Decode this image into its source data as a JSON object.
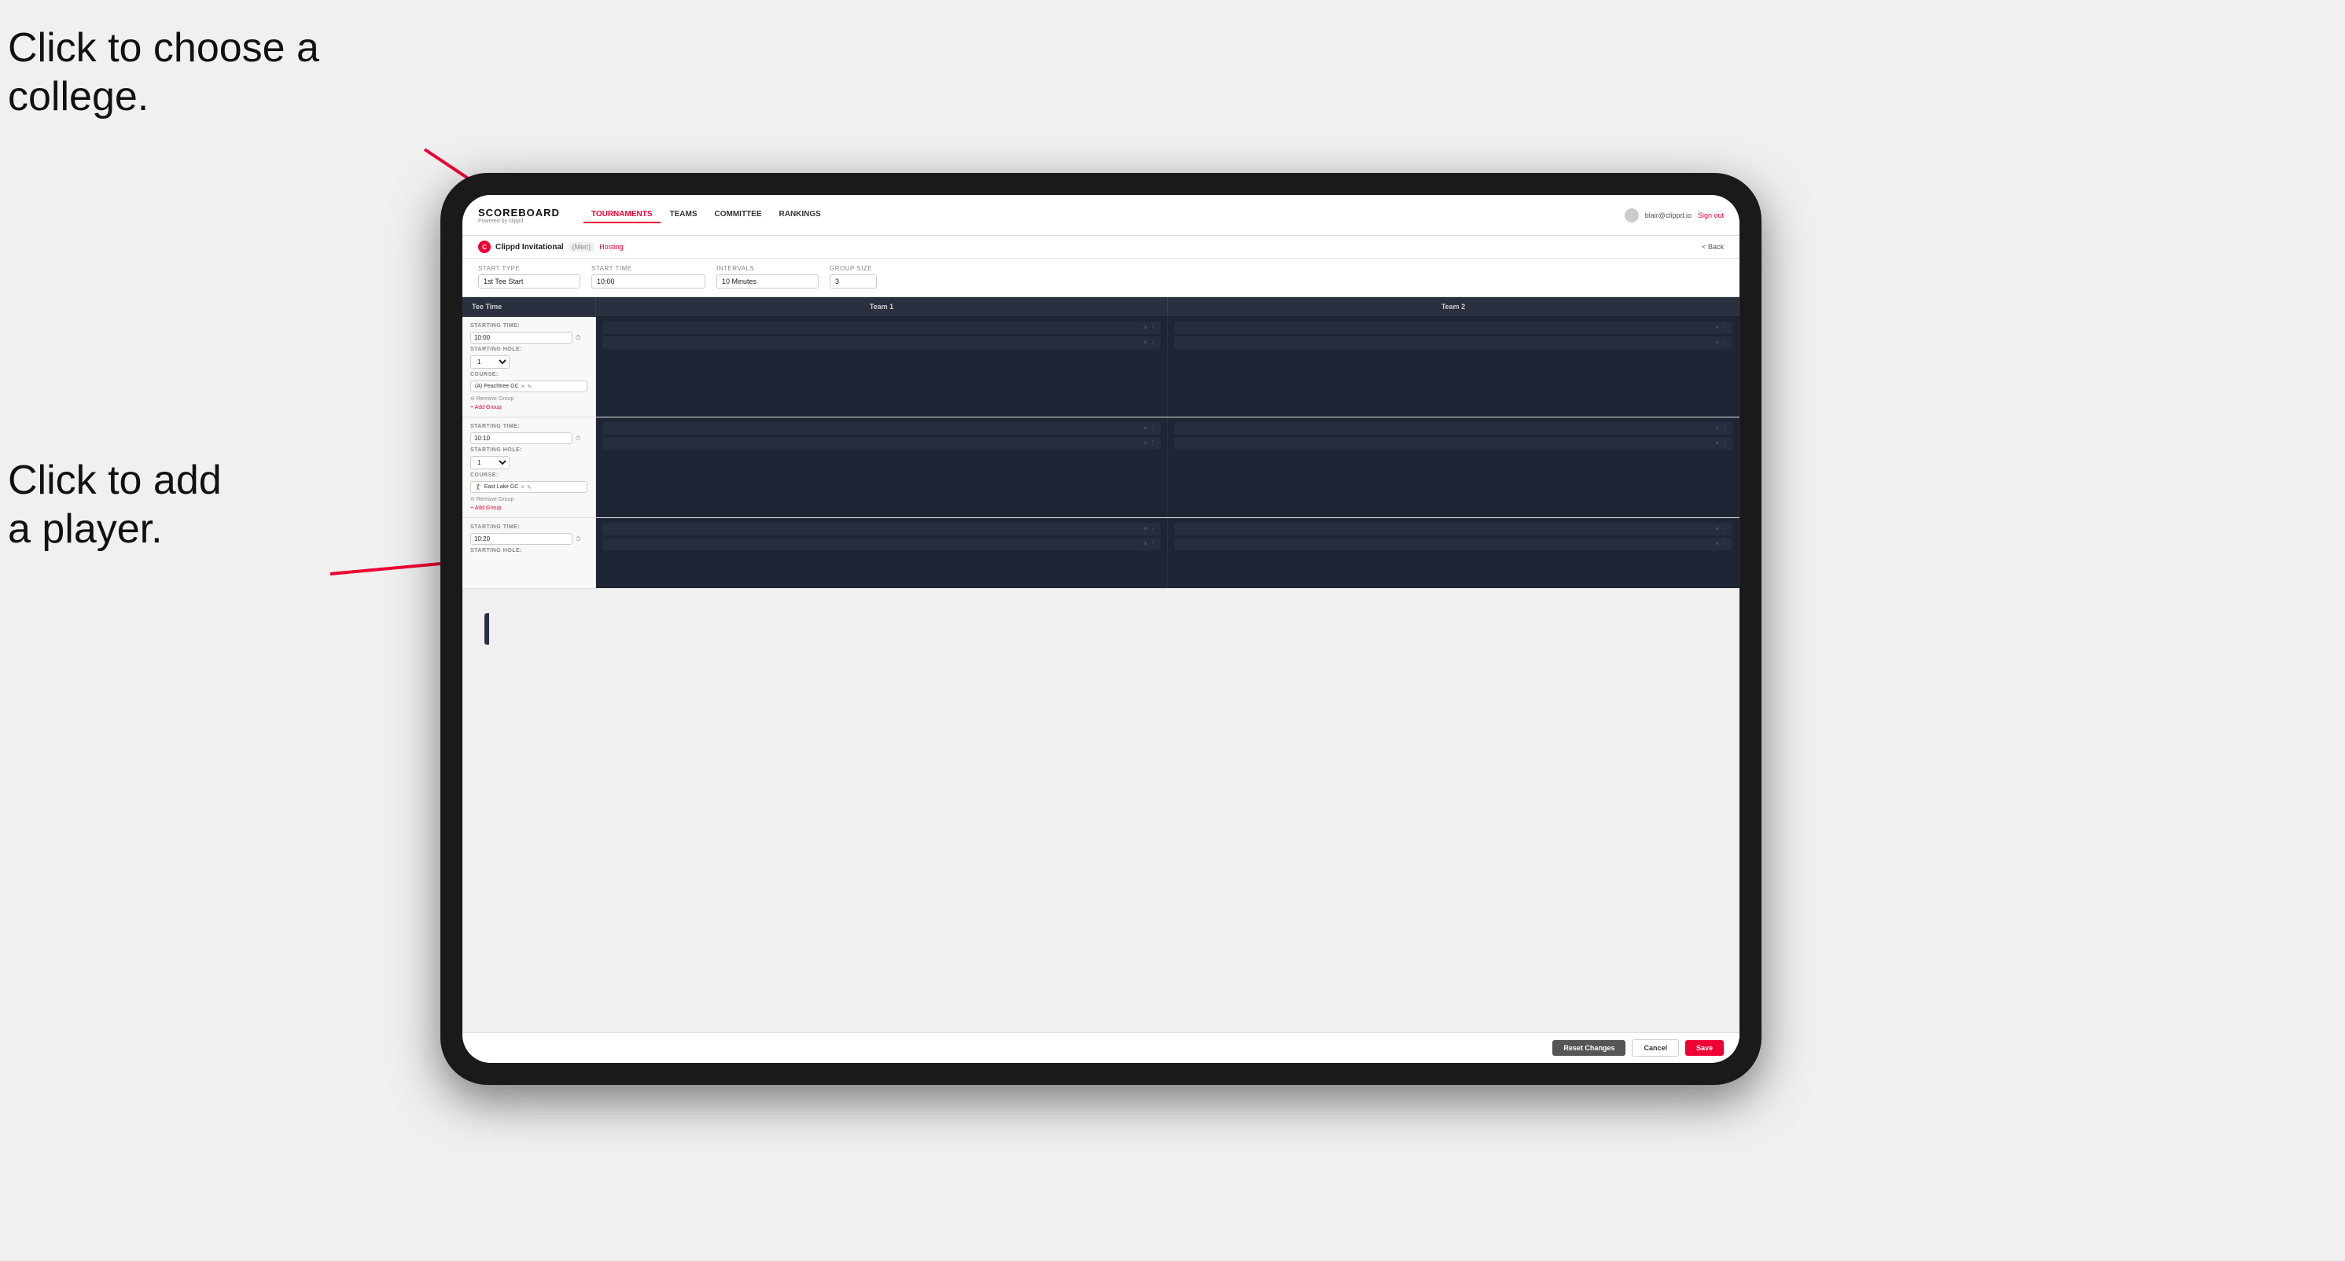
{
  "annotations": {
    "text1_line1": "Click to choose a",
    "text1_line2": "college.",
    "text2_line1": "Click to add",
    "text2_line2": "a player."
  },
  "header": {
    "brand_title": "SCOREBOARD",
    "brand_sub": "Powered by clippd",
    "nav": [
      {
        "label": "TOURNAMENTS",
        "active": true
      },
      {
        "label": "TEAMS",
        "active": false
      },
      {
        "label": "COMMITTEE",
        "active": false
      },
      {
        "label": "RANKINGS",
        "active": false
      }
    ],
    "user_email": "blair@clippd.io",
    "sign_out": "Sign out"
  },
  "breadcrumb": {
    "logo": "C",
    "title": "Clippd Invitational",
    "badge": "(Men)",
    "hosting": "Hosting",
    "back": "< Back"
  },
  "controls": {
    "start_type_label": "Start Type",
    "start_type_value": "1st Tee Start",
    "start_time_label": "Start Time",
    "start_time_value": "10:00",
    "intervals_label": "Intervals",
    "intervals_value": "10 Minutes",
    "group_size_label": "Group Size",
    "group_size_value": "3"
  },
  "table": {
    "col1": "Tee Time",
    "col2": "Team 1",
    "col3": "Team 2"
  },
  "groups": [
    {
      "starting_time": "10:00",
      "starting_hole": "1",
      "course_tag": "(A) Peachtree GC",
      "has_remove_group": true,
      "has_add_group": true,
      "team1_players": [
        {
          "id": "p1"
        },
        {
          "id": "p2"
        }
      ],
      "team2_players": [
        {
          "id": "p3"
        },
        {
          "id": "p4"
        }
      ]
    },
    {
      "starting_time": "10:10",
      "starting_hole": "1",
      "course_tag": "East Lake GC",
      "course_icon": "🏌",
      "has_remove_group": true,
      "has_add_group": true,
      "team1_players": [
        {
          "id": "p5"
        },
        {
          "id": "p6"
        }
      ],
      "team2_players": [
        {
          "id": "p7"
        },
        {
          "id": "p8"
        }
      ]
    },
    {
      "starting_time": "10:20",
      "starting_hole": "",
      "course_tag": "",
      "has_remove_group": false,
      "has_add_group": false,
      "team1_players": [
        {
          "id": "p9"
        },
        {
          "id": "p10"
        }
      ],
      "team2_players": [
        {
          "id": "p11"
        },
        {
          "id": "p12"
        }
      ]
    }
  ],
  "buttons": {
    "reset": "Reset Changes",
    "cancel": "Cancel",
    "save": "Save"
  },
  "field_labels": {
    "starting_time": "STARTING TIME:",
    "starting_hole": "STARTING HOLE:",
    "course": "COURSE:",
    "remove_group": "Remove Group",
    "add_group": "+ Add Group"
  }
}
